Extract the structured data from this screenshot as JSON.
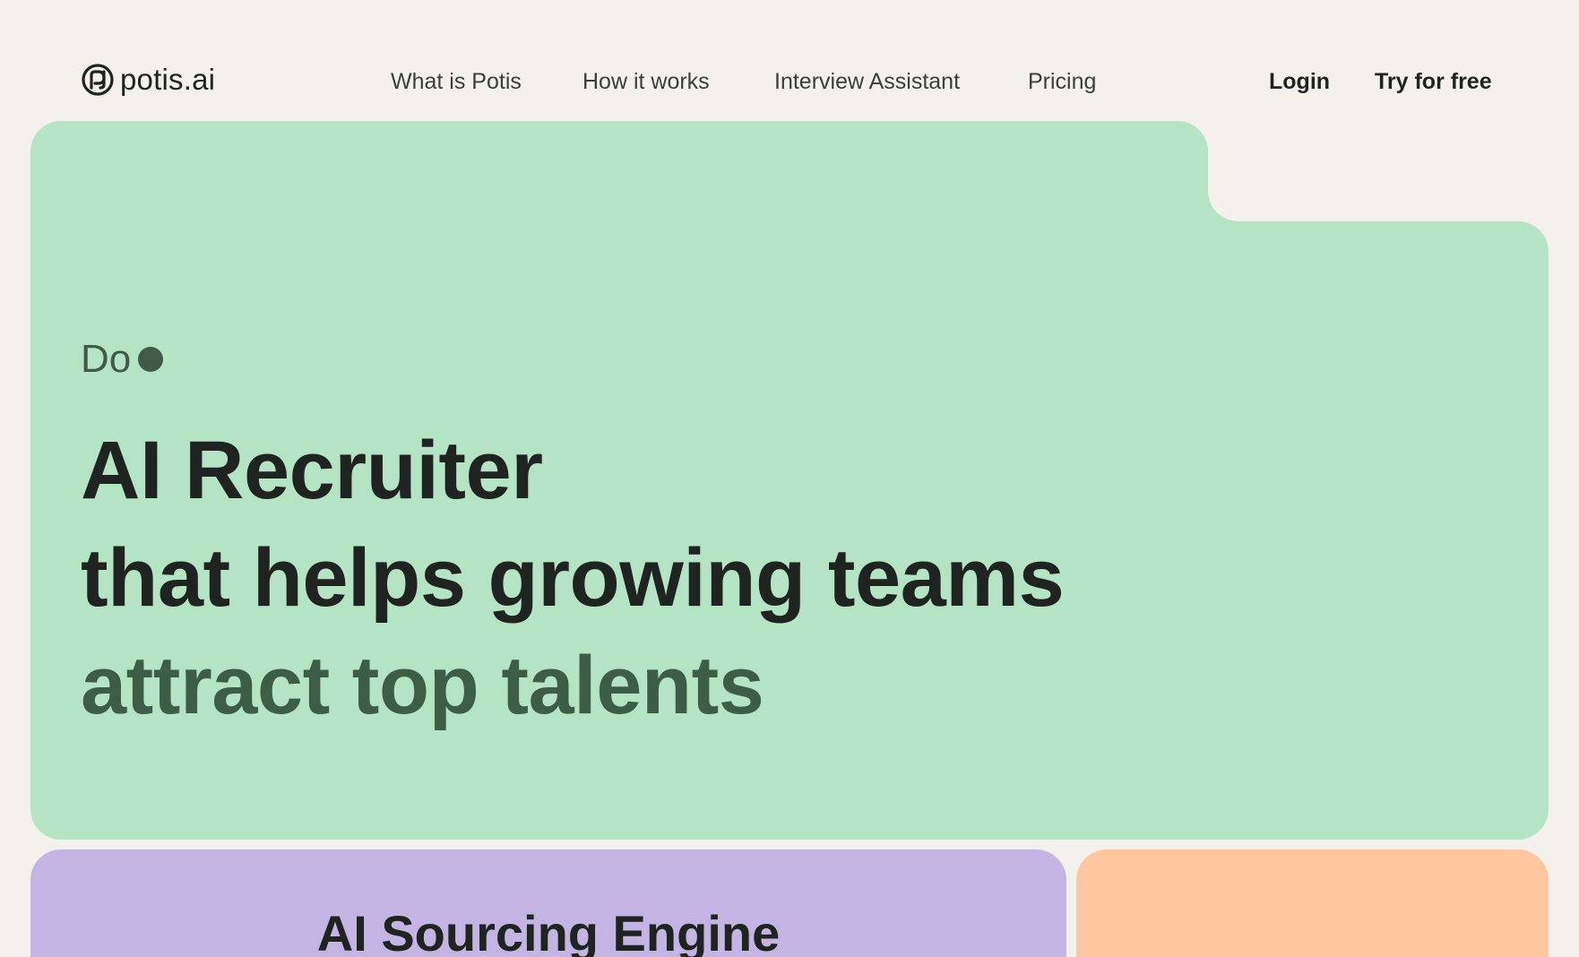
{
  "colors": {
    "page_background": "#f4f0eb",
    "hero_card": "#b4e4c4",
    "accent_green": "#3c5e47",
    "purple_card": "#c4b4e4",
    "orange_card": "#fec79f",
    "text_dark": "#1f2421"
  },
  "header": {
    "logo": {
      "icon": "potis-logo-icon",
      "text": "potis.ai"
    },
    "nav": [
      {
        "label": "What is Potis"
      },
      {
        "label": "How it works"
      },
      {
        "label": "Interview Assistant"
      },
      {
        "label": "Pricing"
      }
    ],
    "login_label": "Login",
    "try_label": "Try for free"
  },
  "hero": {
    "eyebrow": "Do",
    "eyebrow_icon": "dot-icon",
    "headline": {
      "line1": "AI Recruiter",
      "line2": "that helps growing teams",
      "line3": "attract top talents"
    }
  },
  "cards": {
    "purple_title": "AI Sourcing Engine"
  }
}
